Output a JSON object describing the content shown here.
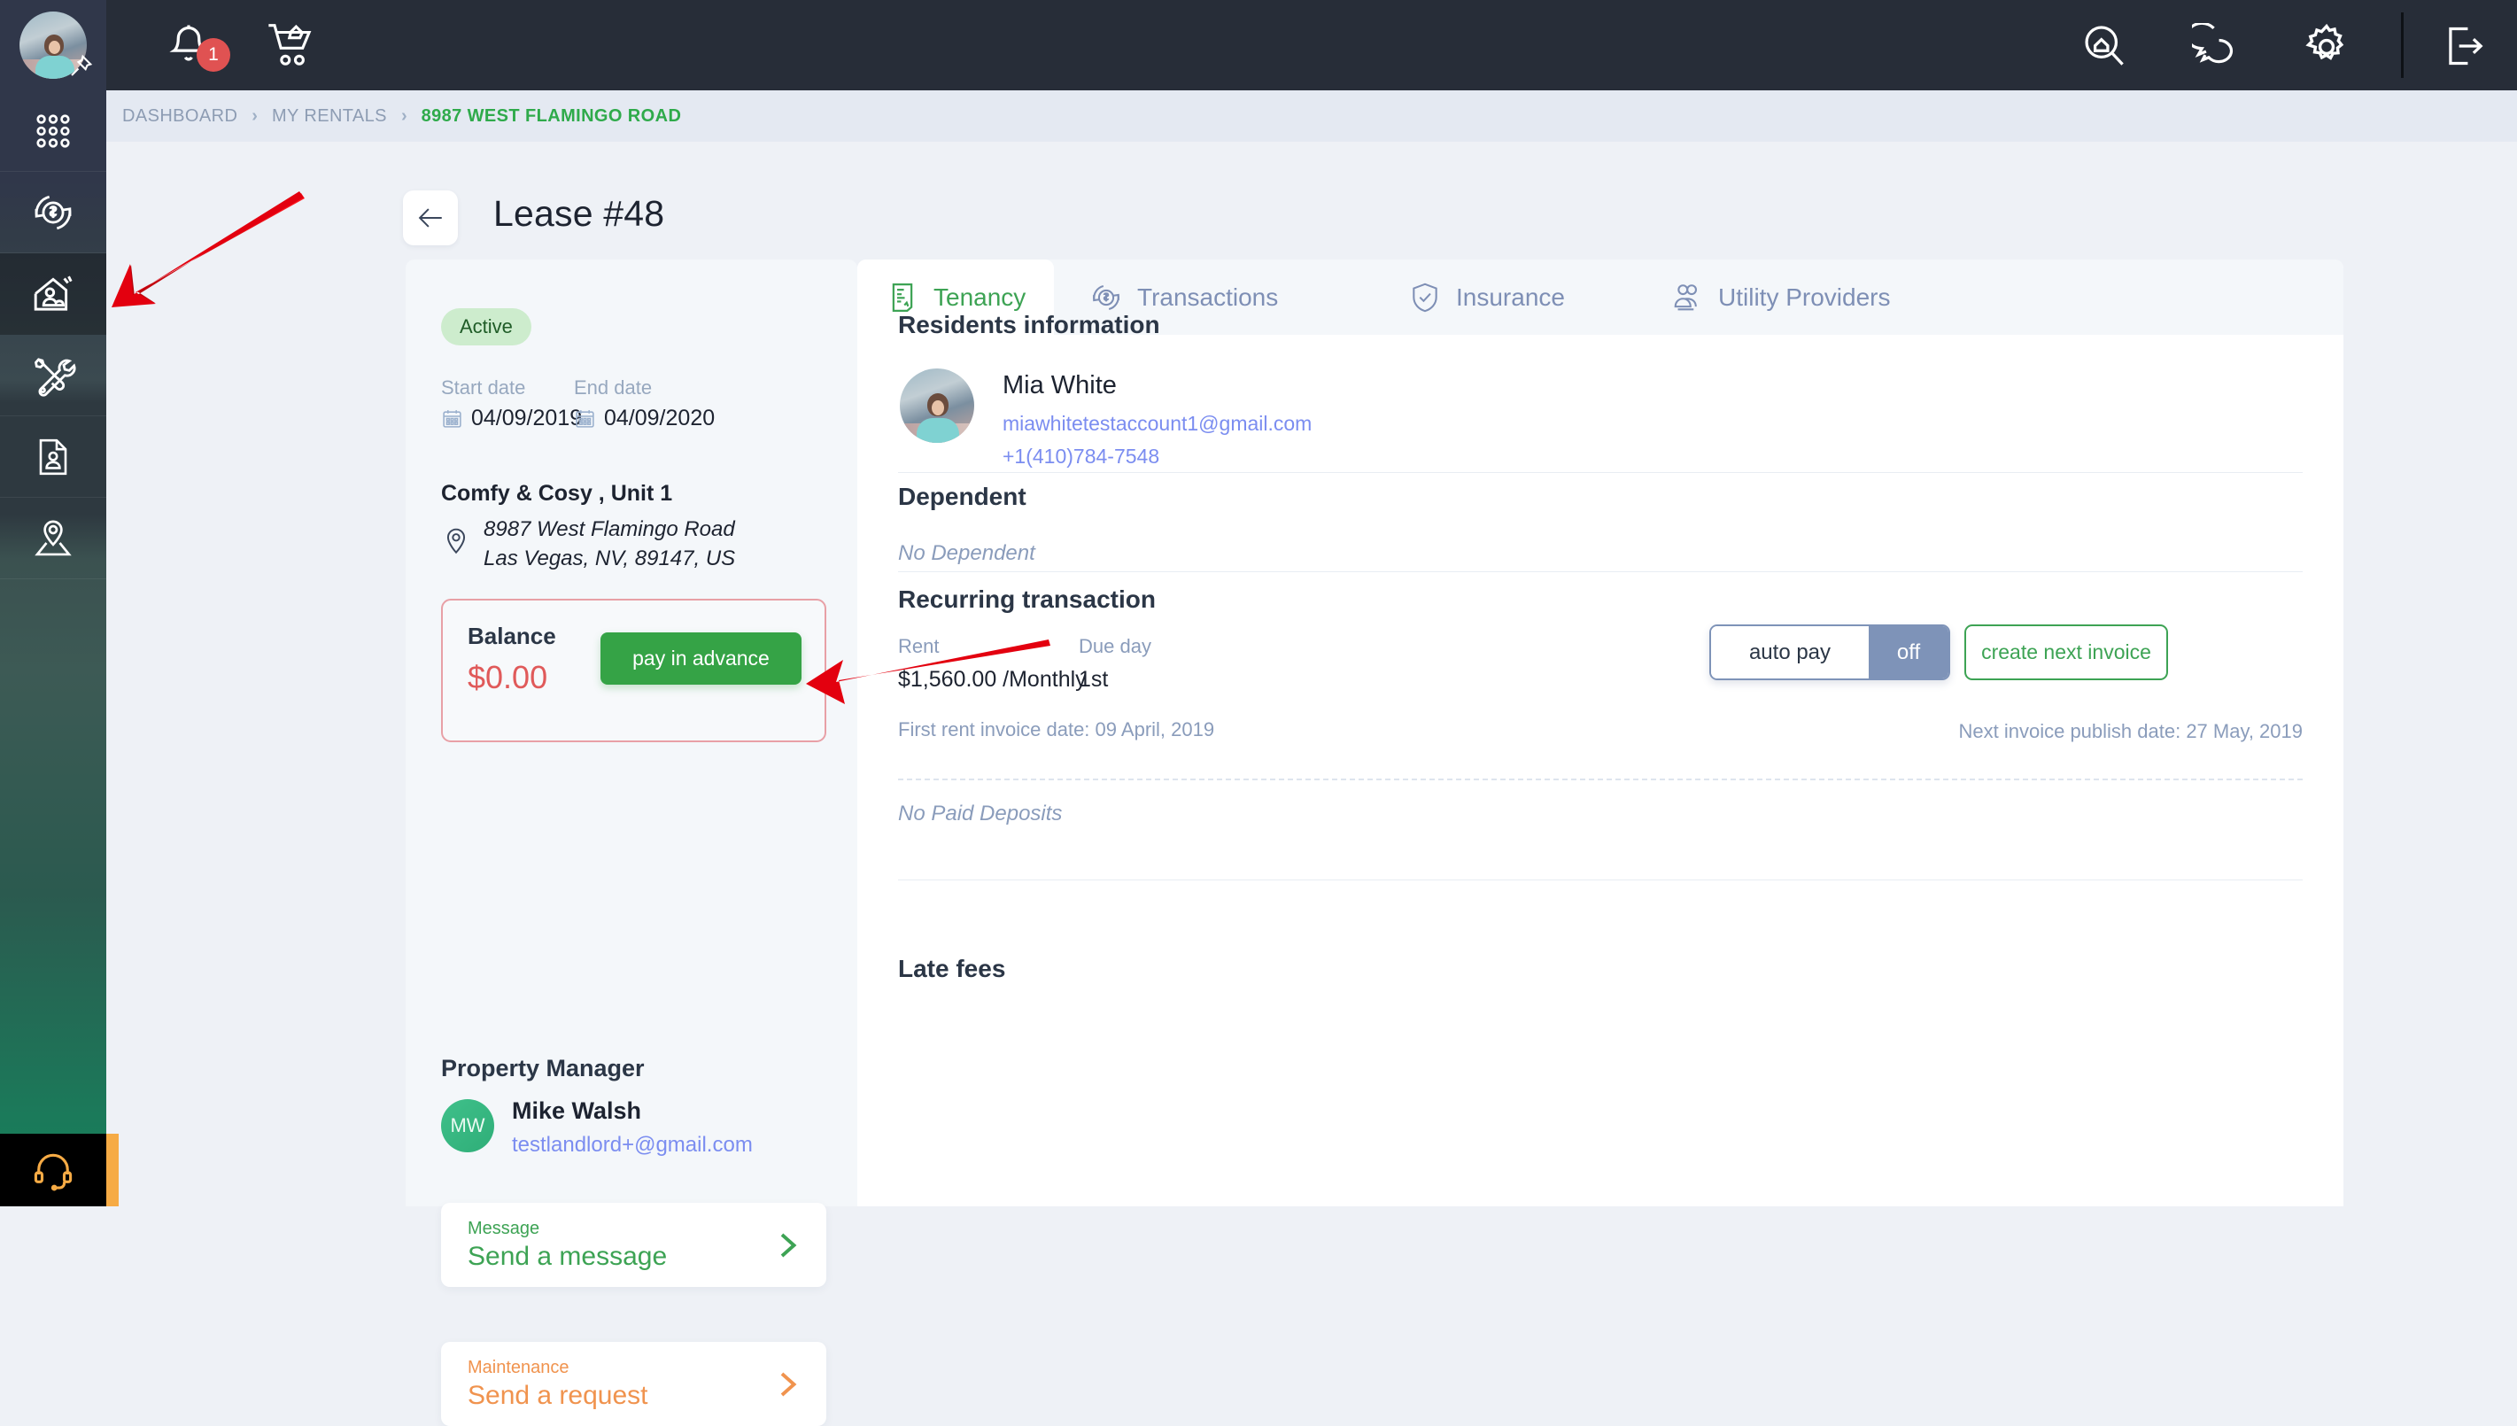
{
  "topbar": {
    "notification_count": "1",
    "icons": [
      "bell-icon",
      "cart-icon",
      "search-home-icon",
      "chat-icon",
      "gear-icon",
      "logout-icon"
    ]
  },
  "sidebar": {
    "items": [
      {
        "name": "apps-grid-icon",
        "active": false
      },
      {
        "name": "transactions-icon",
        "active": false
      },
      {
        "name": "my-rentals-icon",
        "active": true
      },
      {
        "name": "maintenance-icon",
        "active": false
      },
      {
        "name": "documents-icon",
        "active": false
      },
      {
        "name": "map-location-icon",
        "active": false
      }
    ],
    "support_icon": "headset-icon"
  },
  "breadcrumb": {
    "items": [
      {
        "label": "DASHBOARD",
        "current": false
      },
      {
        "label": "MY RENTALS",
        "current": false
      },
      {
        "label": "8987 WEST FLAMINGO ROAD",
        "current": true
      }
    ],
    "separator": "›"
  },
  "header": {
    "back_label": "back",
    "title": "Lease #48"
  },
  "lease": {
    "status": "Active",
    "start_date_label": "Start date",
    "start_date": "04/09/2019",
    "end_date_label": "End date",
    "end_date": "04/09/2020",
    "property_name": "Comfy & Cosy , Unit 1",
    "address_line1": "8987 West Flamingo Road",
    "address_line2": "Las Vegas, NV, 89147, US",
    "balance_label": "Balance",
    "balance_value": "$0.00",
    "pay_in_advance_label": "pay in advance"
  },
  "property_manager": {
    "title": "Property Manager",
    "initials": "MW",
    "name": "Mike Walsh",
    "email": "testlandlord+@gmail.com"
  },
  "actions": {
    "message": {
      "sub": "Message",
      "main": "Send a message"
    },
    "maintenance": {
      "sub": "Maintenance",
      "main": "Send a request"
    }
  },
  "tabs": [
    {
      "label": "Tenancy",
      "icon": "document-lease-icon",
      "active": true
    },
    {
      "label": "Transactions",
      "icon": "dollar-refresh-icon",
      "active": false
    },
    {
      "label": "Insurance",
      "icon": "shield-check-icon",
      "active": false
    },
    {
      "label": "Utility Providers",
      "icon": "people-group-icon",
      "active": false
    }
  ],
  "tenancy": {
    "residents_title": "Residents information",
    "resident": {
      "name": "Mia White",
      "email": "miawhitetestaccount1@gmail.com",
      "phone": "+1(410)784-7548"
    },
    "dependent_title": "Dependent",
    "dependent_empty": "No Dependent",
    "recurring_title": "Recurring transaction",
    "rent_label": "Rent",
    "rent_value": "$1,560.00 /Monthly",
    "due_day_label": "Due day",
    "due_day_value": "1st",
    "first_invoice_note": "First rent invoice date: 09 April, 2019",
    "next_invoice_note": "Next invoice publish date: 27 May, 2019",
    "autopay_label": "auto pay",
    "autopay_state": "off",
    "create_next_invoice_label": "create next invoice",
    "deposits_empty": "No Paid Deposits",
    "late_fees_title": "Late fees"
  },
  "colors": {
    "accent_green": "#35a346",
    "link_blue": "#7b8df0",
    "danger_red": "#e05a5a",
    "orange": "#f0934e",
    "slate_blue": "#7e93b8",
    "annotation_red": "#e3000f"
  }
}
